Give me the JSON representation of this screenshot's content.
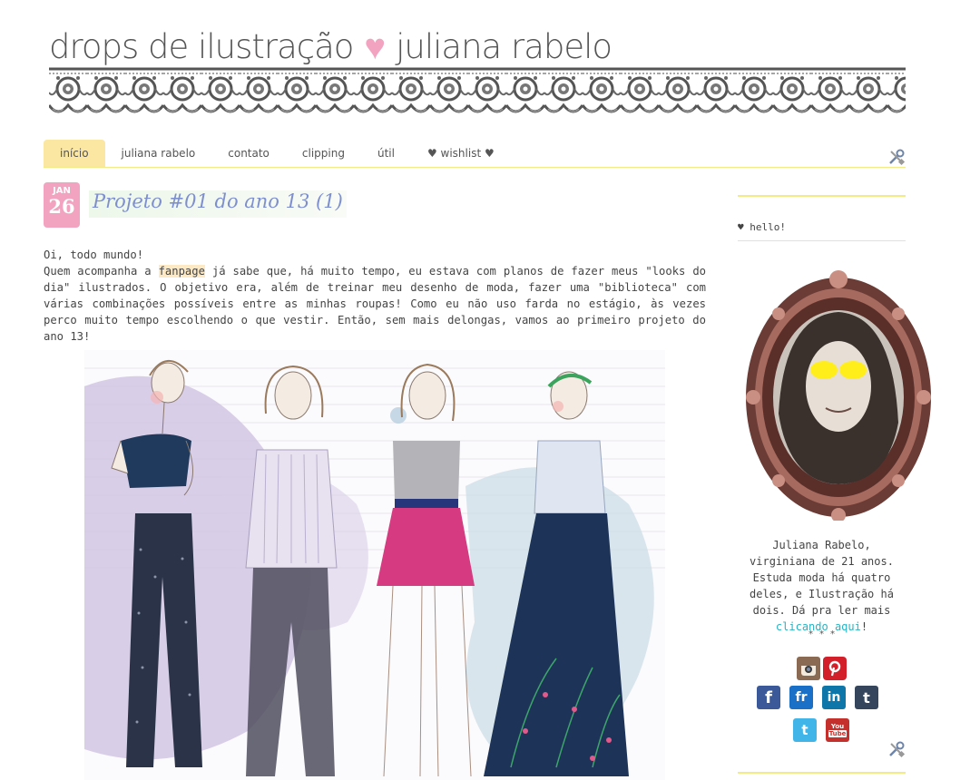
{
  "header": {
    "title_left": "drops de ilustração",
    "title_right": "juliana rabelo"
  },
  "nav": {
    "items": [
      "início",
      "juliana rabelo",
      "contato",
      "clipping",
      "útil",
      "♥ wishlist ♥"
    ],
    "active_index": 0
  },
  "post": {
    "month": "JAN",
    "day": "26",
    "title": "Projeto #01 do ano 13 (1)",
    "p1": "Oi, todo mundo!",
    "p2_before": "Quem acompanha a ",
    "p2_link": "fanpage",
    "p2_after": " já sabe que, há muito tempo, eu estava com planos de fazer meus \"looks do dia\" ilustrados. O objetivo era, além de treinar meu desenho de moda, fazer uma \"biblioteca\" com várias combinações possíveis entre as minhas roupas! Como eu não uso farda no estágio, às vezes perco muito tempo escolhendo o que vestir. Então, sem mais delongas, vamos ao primeiro projeto do ano 13!"
  },
  "sidebar": {
    "hello": "♥ hello!",
    "bio_before": "Juliana Rabelo, virginiana de 21 anos. Estuda moda há quatro deles, e Ilustração há dois. Dá pra ler mais ",
    "bio_link": "clicando aqui",
    "bio_after": "!",
    "stars": "* * *",
    "social": {
      "facebook": "f",
      "flickr": "fr",
      "linkedin": "in",
      "tumblr": "t",
      "twitter": "t",
      "youtube_top": "You",
      "youtube_bottom": "Tube"
    }
  },
  "colors": {
    "accent_pink": "#f2a3bf",
    "nav_active": "#fbe7a1",
    "nav_line": "#f3ec86",
    "link_teal": "#29b3c2",
    "title_blue": "#7e8fcf"
  },
  "icons": [
    "heart-icon",
    "tools-icon",
    "instagram-icon",
    "pinterest-icon",
    "facebook-icon",
    "flickr-icon",
    "linkedin-icon",
    "tumblr-icon",
    "twitter-icon",
    "youtube-icon"
  ]
}
